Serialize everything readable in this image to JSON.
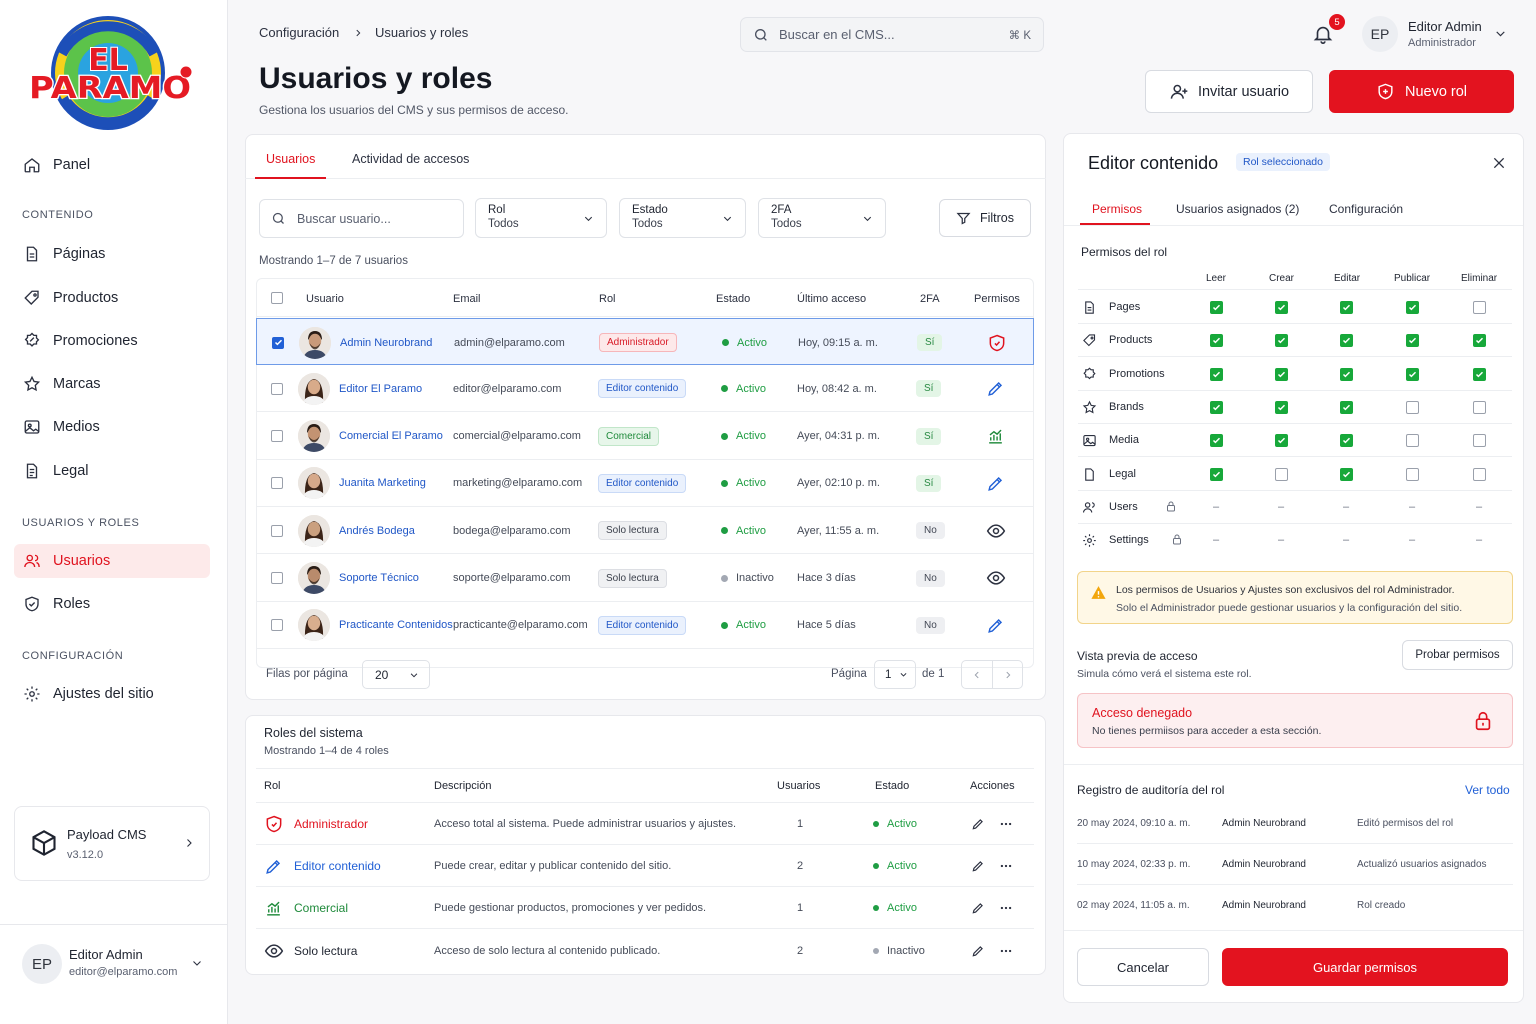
{
  "brand": {
    "logo_top": "PALETERIA MAYORISTA",
    "logo_word1": "EL",
    "logo_word2": "PARAMO",
    "logo_bottom": "EL PARAISO DE LOS DULCES"
  },
  "sidebar": {
    "panel": "Panel",
    "sec_content": "CONTENIDO",
    "content_items": [
      "Páginas",
      "Productos",
      "Promociones",
      "Marcas",
      "Medios",
      "Legal"
    ],
    "sec_users": "USUARIOS Y ROLES",
    "users": "Usuarios",
    "roles": "Roles",
    "sec_config": "CONFIGURACIÓN",
    "settings": "Ajustes del sitio",
    "payload_name": "Payload CMS",
    "payload_version": "v3.12.0",
    "user_initials": "EP",
    "user_name": "Editor Admin",
    "user_email": "editor@elparamo.com"
  },
  "header": {
    "crumb1": "Configuración",
    "crumb2": "Usuarios y roles",
    "search_placeholder": "Buscar en el CMS...",
    "search_shortcut": "⌘ K",
    "notif_count": "5",
    "user_initials": "EP",
    "user_name": "Editor Admin",
    "user_role": "Administrador",
    "title": "Usuarios y roles",
    "subtitle": "Gestiona los usuarios del CMS y sus permisos de acceso.",
    "invite": "Invitar usuario",
    "new_role": "Nuevo rol"
  },
  "users_panel": {
    "tab_users": "Usuarios",
    "tab_activity": "Actividad de accesos",
    "search_placeholder": "Buscar usuario...",
    "f_rol": "Rol",
    "f_rol_v": "Todos",
    "f_estado": "Estado",
    "f_estado_v": "Todos",
    "f_2fa": "2FA",
    "f_2fa_v": "Todos",
    "filters": "Filtros",
    "showing": "Mostrando 1–7 de 7 usuarios",
    "cols": [
      "Usuario",
      "Email",
      "Rol",
      "Estado",
      "Último acceso",
      "2FA",
      "Permisos"
    ],
    "rows": [
      {
        "name": "Admin Neurobrand",
        "email": "admin@elparamo.com",
        "role": "Administrador",
        "status": "Activo",
        "last": "Hoy, 09:15 a. m.",
        "twofa": "Sí"
      },
      {
        "name": "Editor El Paramo",
        "email": "editor@elparamo.com",
        "role": "Editor contenido",
        "status": "Activo",
        "last": "Hoy, 08:42 a. m.",
        "twofa": "Sí"
      },
      {
        "name": "Comercial El Paramo",
        "email": "comercial@elparamo.com",
        "role": "Comercial",
        "status": "Activo",
        "last": "Ayer, 04:31 p. m.",
        "twofa": "Sí"
      },
      {
        "name": "Juanita Marketing",
        "email": "marketing@elparamo.com",
        "role": "Editor contenido",
        "status": "Activo",
        "last": "Ayer, 02:10 p. m.",
        "twofa": "Sí"
      },
      {
        "name": "Andrés Bodega",
        "email": "bodega@elparamo.com",
        "role": "Solo lectura",
        "status": "Activo",
        "last": "Ayer, 11:55 a. m.",
        "twofa": "No"
      },
      {
        "name": "Soporte Técnico",
        "email": "soporte@elparamo.com",
        "role": "Solo lectura",
        "status": "Inactivo",
        "last": "Hace 3 días",
        "twofa": "No"
      },
      {
        "name": "Practicante Contenidos",
        "email": "practicante@elparamo.com",
        "role": "Editor contenido",
        "status": "Activo",
        "last": "Hace 5 días",
        "twofa": "No"
      }
    ],
    "rows_per_page": "Filas por página",
    "rows_value": "20",
    "page_label": "Página",
    "page_value": "1",
    "page_of": "de 1"
  },
  "roles_panel": {
    "title": "Roles del sistema",
    "showing": "Mostrando 1–4 de 4 roles",
    "cols": [
      "Rol",
      "Descripción",
      "Usuarios",
      "Estado",
      "Acciones"
    ],
    "rows": [
      {
        "name": "Administrador",
        "desc": "Acceso total al sistema. Puede administrar usuarios y ajustes.",
        "users": "1",
        "status": "Activo"
      },
      {
        "name": "Editor contenido",
        "desc": "Puede crear, editar y publicar contenido del sitio.",
        "users": "2",
        "status": "Activo"
      },
      {
        "name": "Comercial",
        "desc": "Puede gestionar productos, promociones y ver pedidos.",
        "users": "1",
        "status": "Activo"
      },
      {
        "name": "Solo lectura",
        "desc": "Acceso de solo lectura al contenido publicado.",
        "users": "2",
        "status": "Inactivo"
      }
    ]
  },
  "role_panel": {
    "title": "Editor contenido",
    "badge": "Rol seleccionado",
    "tabs": [
      "Permisos",
      "Usuarios asignados (2)",
      "Configuración"
    ],
    "section": "Permisos del rol",
    "cols": [
      "Leer",
      "Crear",
      "Editar",
      "Publicar",
      "Eliminar"
    ],
    "perms": [
      {
        "name": "Pages",
        "vals": [
          true,
          true,
          true,
          true,
          false
        ]
      },
      {
        "name": "Products",
        "vals": [
          true,
          true,
          true,
          true,
          true
        ]
      },
      {
        "name": "Promotions",
        "vals": [
          true,
          true,
          true,
          true,
          true
        ]
      },
      {
        "name": "Brands",
        "vals": [
          true,
          true,
          true,
          false,
          false
        ]
      },
      {
        "name": "Media",
        "vals": [
          true,
          true,
          true,
          false,
          false
        ]
      },
      {
        "name": "Legal",
        "vals": [
          true,
          false,
          true,
          false,
          false
        ]
      }
    ],
    "locked": [
      "Users",
      "Settings"
    ],
    "dash": "–",
    "warning_1": "Los permisos de Usuarios y Ajustes son exclusivos del rol Administrador.",
    "warning_2": "Solo el Administrador puede gestionar usuarios y la configuración del sitio.",
    "preview_title": "Vista previa de acceso",
    "preview_sub": "Simula cómo verá el sistema este rol.",
    "test_btn": "Probar permisos",
    "denied_title": "Acceso denegado",
    "denied_text": "No tienes permiisos para acceder a esta sección.",
    "audit_title": "Registro de auditoría del rol",
    "audit_link": "Ver todo",
    "audit": [
      {
        "date": "20 may 2024, 09:10 a. m.",
        "user": "Admin Neurobrand",
        "action": "Editó permisos del rol"
      },
      {
        "date": "10 may 2024, 02:33 p. m.",
        "user": "Admin Neurobrand",
        "action": "Actualizó usuarios asignados"
      },
      {
        "date": "02 may 2024, 11:05 a. m.",
        "user": "Admin Neurobrand",
        "action": "Rol creado"
      }
    ],
    "cancel": "Cancelar",
    "save": "Guardar permisos"
  }
}
